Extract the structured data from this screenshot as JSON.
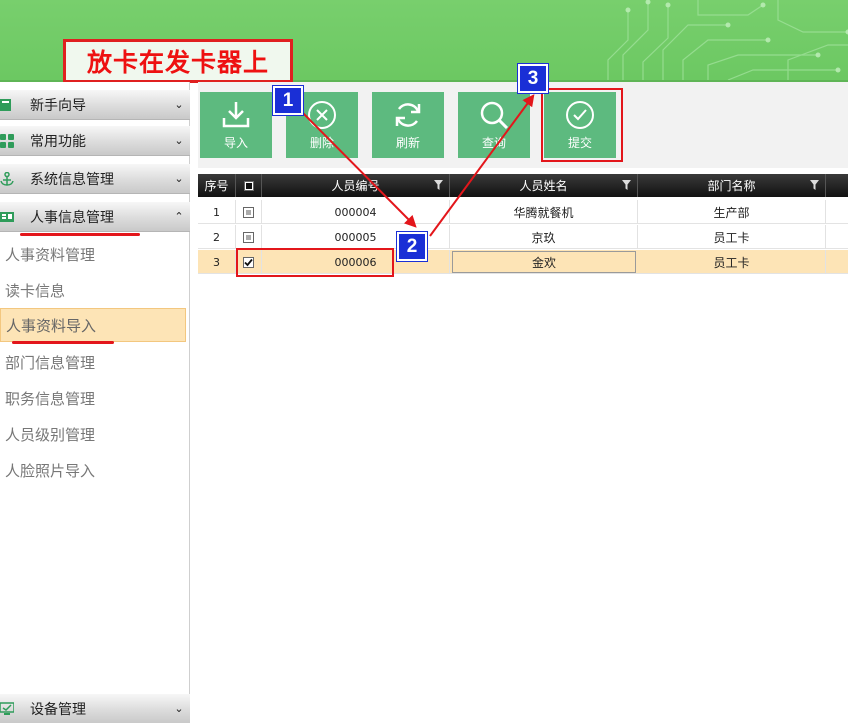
{
  "instruction": "放卡在发卡器上",
  "sidebar": {
    "groups": [
      {
        "label": "新手向导",
        "chevron": "⌄"
      },
      {
        "label": "常用功能",
        "chevron": "⌄"
      },
      {
        "label": "系统信息管理",
        "chevron": "⌄"
      },
      {
        "label": "人事信息管理",
        "chevron": "⌃"
      }
    ],
    "sub_items": [
      "人事资料管理",
      "读卡信息",
      "人事资料导入",
      "部门信息管理",
      "职务信息管理",
      "人员级别管理",
      "人脸照片导入"
    ],
    "bottom_group": {
      "label": "设备管理",
      "chevron": "⌄"
    }
  },
  "toolbar": {
    "import_label": "导入",
    "delete_label": "删除",
    "refresh_label": "刷新",
    "query_label": "查询",
    "submit_label": "提交"
  },
  "table": {
    "headers": {
      "seq": "序号",
      "emp_no": "人员编号",
      "name": "人员姓名",
      "dept": "部门名称"
    },
    "rows": [
      {
        "seq": "1",
        "checked": false,
        "emp_no": "000004",
        "name": "华腾就餐机",
        "dept": "生产部"
      },
      {
        "seq": "2",
        "checked": false,
        "emp_no": "000005",
        "name": "京玖",
        "dept": "员工卡"
      },
      {
        "seq": "3",
        "checked": true,
        "emp_no": "000006",
        "name": "金欢",
        "dept": "员工卡"
      }
    ]
  },
  "markers": [
    "1",
    "2",
    "3"
  ],
  "colors": {
    "header_green": "#6cc862",
    "button_green": "#5dba7f",
    "annotation_red": "#e3161b",
    "marker_blue": "#1a2fd6",
    "selected_row": "#fde4b6"
  }
}
